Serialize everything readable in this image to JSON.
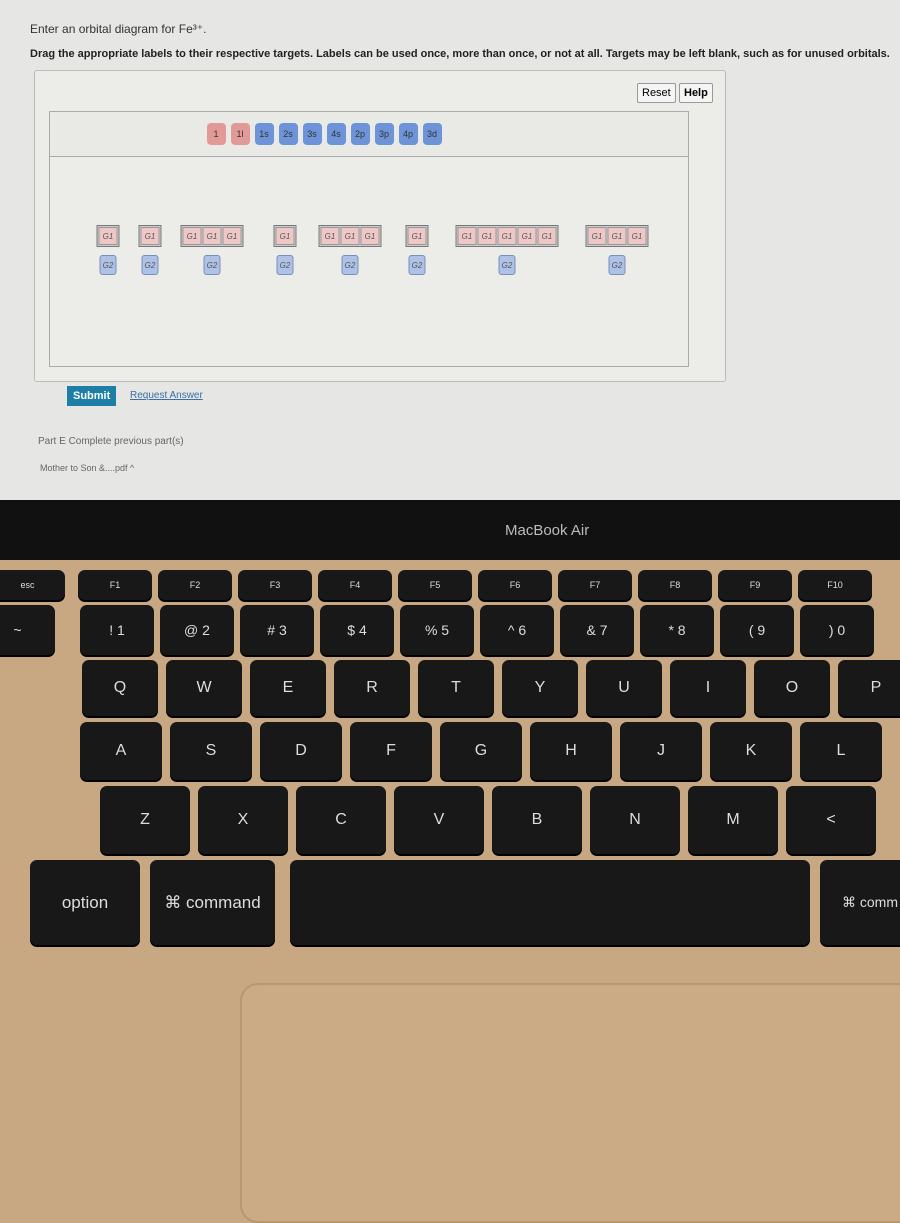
{
  "question": {
    "title": "Enter an orbital diagram for Fe³⁺.",
    "instructions": "Drag the appropriate labels to their respective targets. Labels can be used once, more than once, or not at all. Targets may be left blank, such as for unused orbitals."
  },
  "toolbar": {
    "reset": "Reset",
    "help": "Help"
  },
  "labels": [
    {
      "text": "1",
      "kind": "arrow"
    },
    {
      "text": "1l",
      "kind": "arrow"
    },
    {
      "text": "1s",
      "kind": "orbital"
    },
    {
      "text": "2s",
      "kind": "orbital"
    },
    {
      "text": "3s",
      "kind": "orbital"
    },
    {
      "text": "4s",
      "kind": "orbital"
    },
    {
      "text": "2p",
      "kind": "orbital"
    },
    {
      "text": "3p",
      "kind": "orbital"
    },
    {
      "text": "4p",
      "kind": "orbital"
    },
    {
      "text": "3d",
      "kind": "orbital"
    }
  ],
  "colors": {
    "arrow": "#e29a98",
    "orbital": "#6d94d8",
    "submit": "#1d7fa6"
  },
  "targets": {
    "g1": "G1",
    "g2": "G2",
    "groups": [
      1,
      1,
      3,
      1,
      3,
      1,
      5,
      3
    ]
  },
  "actions": {
    "submit": "Submit",
    "request": "Request Answer"
  },
  "part_e": "Part E  Complete previous part(s)",
  "download": "Mother to Son &....pdf  ^",
  "laptop": {
    "brand": "MacBook Air"
  },
  "keyboard": {
    "fn": [
      "esc",
      "F1",
      "F2",
      "F3",
      "F4",
      "F5",
      "F6",
      "F7",
      "F8",
      "F9",
      "F10"
    ],
    "num": [
      "~",
      "! 1",
      "@ 2",
      "# 3",
      "$ 4",
      "% 5",
      "^ 6",
      "& 7",
      "* 8",
      "( 9",
      ") 0"
    ],
    "top": [
      "Q",
      "W",
      "E",
      "R",
      "T",
      "Y",
      "U",
      "I",
      "O",
      "P"
    ],
    "home": [
      "A",
      "S",
      "D",
      "F",
      "G",
      "H",
      "J",
      "K",
      "L"
    ],
    "bottom": [
      "Z",
      "X",
      "C",
      "V",
      "B",
      "N",
      "M",
      "<"
    ],
    "mods": [
      "option",
      "⌘ command",
      "⌘ comm"
    ]
  }
}
